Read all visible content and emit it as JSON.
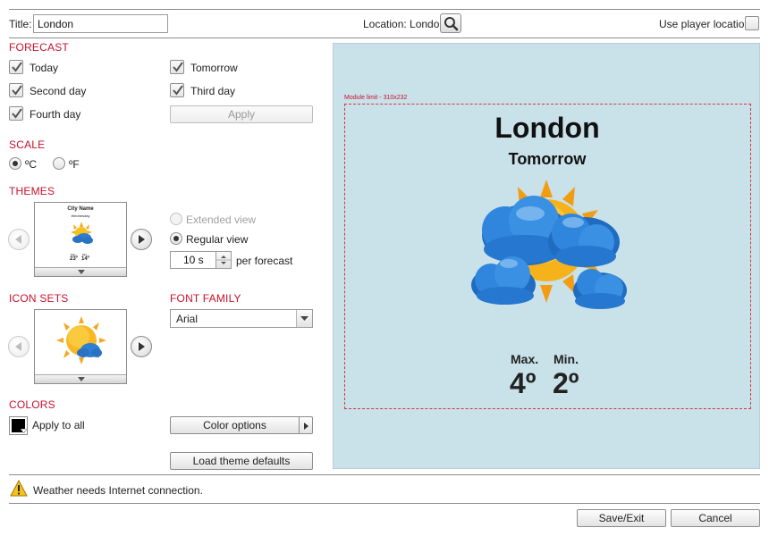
{
  "header": {
    "title_label": "Title:",
    "title_value": "London",
    "location_label": "Location: London",
    "use_player_location_label": "Use player location"
  },
  "forecast": {
    "section_label": "FORECAST",
    "items": [
      {
        "label": "Today",
        "checked": true
      },
      {
        "label": "Tomorrow",
        "checked": true
      },
      {
        "label": "Second day",
        "checked": true
      },
      {
        "label": "Third day",
        "checked": true
      },
      {
        "label": "Fourth day",
        "checked": true
      }
    ],
    "apply_label": "Apply"
  },
  "scale": {
    "section_label": "SCALE",
    "celsius_label": "ºC",
    "fahrenheit_label": "ºF",
    "selected": "celsius"
  },
  "themes": {
    "section_label": "THEMES",
    "thumb_city": "City Name",
    "thumb_day": "Wednesday",
    "thumb_max_label": "Max.",
    "thumb_min_label": "Min.",
    "thumb_max": "23º",
    "thumb_min": "14º",
    "extended_view_label": "Extended view",
    "regular_view_label": "Regular view",
    "duration_value": "10 s",
    "per_forecast_label": "per forecast"
  },
  "icon_sets": {
    "section_label": "ICON SETS"
  },
  "font_family": {
    "section_label": "FONT FAMILY",
    "selected": "Arial"
  },
  "colors": {
    "section_label": "COLORS",
    "apply_to_all_label": "Apply to all",
    "swatch_color": "#000000",
    "color_options_label": "Color options",
    "load_defaults_label": "Load theme defaults"
  },
  "preview": {
    "module_limit_label": "Module limit - 310x232",
    "city": "London",
    "day": "Tomorrow",
    "max_label": "Max.",
    "min_label": "Min.",
    "max_value": "4º",
    "min_value": "2º",
    "background_color": "#c9e2ea"
  },
  "status": {
    "warning_text": "Weather needs Internet connection."
  },
  "footer": {
    "save_label": "Save/Exit",
    "cancel_label": "Cancel"
  }
}
